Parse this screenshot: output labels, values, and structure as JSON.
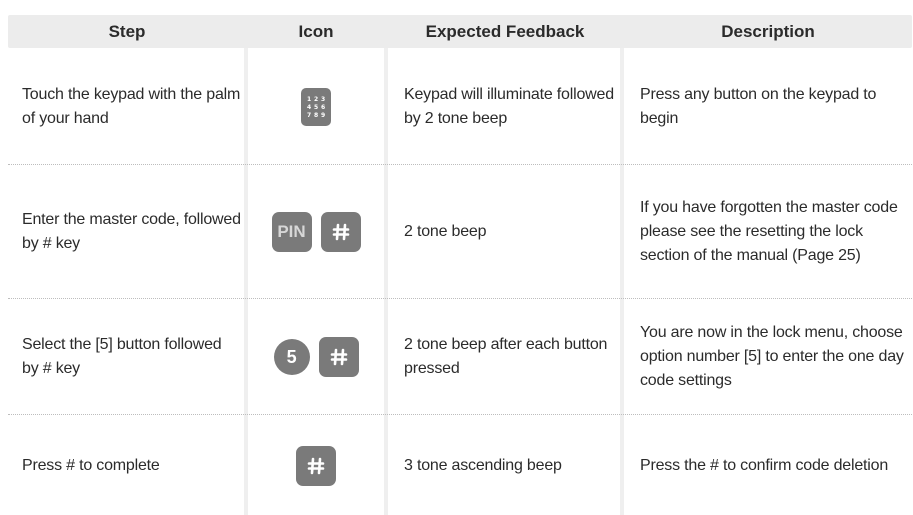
{
  "headers": {
    "step": "Step",
    "icon": "Icon",
    "feedback": "Expected Feedback",
    "description": "Description"
  },
  "rows": [
    {
      "step": "Touch the keypad with the palm of your hand",
      "icons": [
        "keypad-icon"
      ],
      "feedback": "Keypad will illuminate followed by 2 tone beep",
      "description": "Press any button on the keypad to begin"
    },
    {
      "step": "Enter the master code, followed by # key",
      "icons": [
        "pin-icon",
        "hash-key-icon"
      ],
      "pin_label": "PIN",
      "feedback": "2 tone beep",
      "description": "If you have forgotten the master code please see the resetting the lock section of the manual (Page 25)"
    },
    {
      "step": "Select the [5] button followed by # key",
      "icons": [
        "number-5-icon",
        "hash-key-icon"
      ],
      "number_label": "5",
      "feedback": "2 tone beep after each button pressed",
      "description": "You are now in the lock menu, choose option number [5] to enter the one day code settings"
    },
    {
      "step": "Press # to complete",
      "icons": [
        "hash-key-icon"
      ],
      "feedback": "3 tone ascending beep",
      "description": "Press the # to confirm code deletion"
    }
  ],
  "keypad_digits": [
    "1",
    "2",
    "3",
    "4",
    "5",
    "6",
    "7",
    "8",
    "9"
  ],
  "colors": {
    "header_bg": "#ececec",
    "icon_bg": "#7a7a7a",
    "text": "#2b2b2b"
  }
}
